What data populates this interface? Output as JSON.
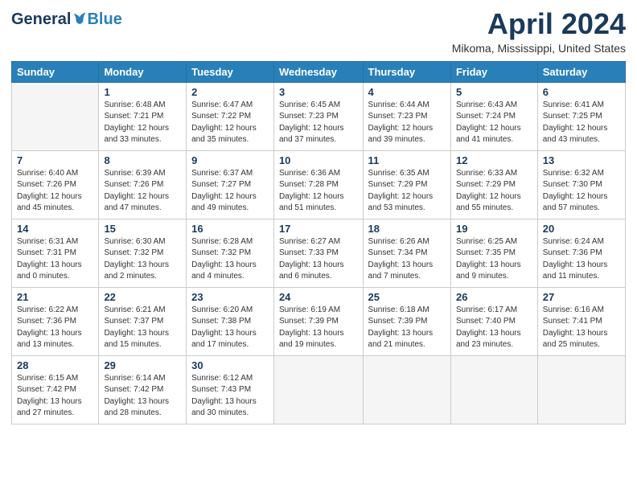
{
  "header": {
    "logo_general": "General",
    "logo_blue": "Blue",
    "month": "April 2024",
    "location": "Mikoma, Mississippi, United States"
  },
  "days_of_week": [
    "Sunday",
    "Monday",
    "Tuesday",
    "Wednesday",
    "Thursday",
    "Friday",
    "Saturday"
  ],
  "weeks": [
    [
      {
        "day": "",
        "info": ""
      },
      {
        "day": "1",
        "info": "Sunrise: 6:48 AM\nSunset: 7:21 PM\nDaylight: 12 hours\nand 33 minutes."
      },
      {
        "day": "2",
        "info": "Sunrise: 6:47 AM\nSunset: 7:22 PM\nDaylight: 12 hours\nand 35 minutes."
      },
      {
        "day": "3",
        "info": "Sunrise: 6:45 AM\nSunset: 7:23 PM\nDaylight: 12 hours\nand 37 minutes."
      },
      {
        "day": "4",
        "info": "Sunrise: 6:44 AM\nSunset: 7:23 PM\nDaylight: 12 hours\nand 39 minutes."
      },
      {
        "day": "5",
        "info": "Sunrise: 6:43 AM\nSunset: 7:24 PM\nDaylight: 12 hours\nand 41 minutes."
      },
      {
        "day": "6",
        "info": "Sunrise: 6:41 AM\nSunset: 7:25 PM\nDaylight: 12 hours\nand 43 minutes."
      }
    ],
    [
      {
        "day": "7",
        "info": "Sunrise: 6:40 AM\nSunset: 7:26 PM\nDaylight: 12 hours\nand 45 minutes."
      },
      {
        "day": "8",
        "info": "Sunrise: 6:39 AM\nSunset: 7:26 PM\nDaylight: 12 hours\nand 47 minutes."
      },
      {
        "day": "9",
        "info": "Sunrise: 6:37 AM\nSunset: 7:27 PM\nDaylight: 12 hours\nand 49 minutes."
      },
      {
        "day": "10",
        "info": "Sunrise: 6:36 AM\nSunset: 7:28 PM\nDaylight: 12 hours\nand 51 minutes."
      },
      {
        "day": "11",
        "info": "Sunrise: 6:35 AM\nSunset: 7:29 PM\nDaylight: 12 hours\nand 53 minutes."
      },
      {
        "day": "12",
        "info": "Sunrise: 6:33 AM\nSunset: 7:29 PM\nDaylight: 12 hours\nand 55 minutes."
      },
      {
        "day": "13",
        "info": "Sunrise: 6:32 AM\nSunset: 7:30 PM\nDaylight: 12 hours\nand 57 minutes."
      }
    ],
    [
      {
        "day": "14",
        "info": "Sunrise: 6:31 AM\nSunset: 7:31 PM\nDaylight: 13 hours\nand 0 minutes."
      },
      {
        "day": "15",
        "info": "Sunrise: 6:30 AM\nSunset: 7:32 PM\nDaylight: 13 hours\nand 2 minutes."
      },
      {
        "day": "16",
        "info": "Sunrise: 6:28 AM\nSunset: 7:32 PM\nDaylight: 13 hours\nand 4 minutes."
      },
      {
        "day": "17",
        "info": "Sunrise: 6:27 AM\nSunset: 7:33 PM\nDaylight: 13 hours\nand 6 minutes."
      },
      {
        "day": "18",
        "info": "Sunrise: 6:26 AM\nSunset: 7:34 PM\nDaylight: 13 hours\nand 7 minutes."
      },
      {
        "day": "19",
        "info": "Sunrise: 6:25 AM\nSunset: 7:35 PM\nDaylight: 13 hours\nand 9 minutes."
      },
      {
        "day": "20",
        "info": "Sunrise: 6:24 AM\nSunset: 7:36 PM\nDaylight: 13 hours\nand 11 minutes."
      }
    ],
    [
      {
        "day": "21",
        "info": "Sunrise: 6:22 AM\nSunset: 7:36 PM\nDaylight: 13 hours\nand 13 minutes."
      },
      {
        "day": "22",
        "info": "Sunrise: 6:21 AM\nSunset: 7:37 PM\nDaylight: 13 hours\nand 15 minutes."
      },
      {
        "day": "23",
        "info": "Sunrise: 6:20 AM\nSunset: 7:38 PM\nDaylight: 13 hours\nand 17 minutes."
      },
      {
        "day": "24",
        "info": "Sunrise: 6:19 AM\nSunset: 7:39 PM\nDaylight: 13 hours\nand 19 minutes."
      },
      {
        "day": "25",
        "info": "Sunrise: 6:18 AM\nSunset: 7:39 PM\nDaylight: 13 hours\nand 21 minutes."
      },
      {
        "day": "26",
        "info": "Sunrise: 6:17 AM\nSunset: 7:40 PM\nDaylight: 13 hours\nand 23 minutes."
      },
      {
        "day": "27",
        "info": "Sunrise: 6:16 AM\nSunset: 7:41 PM\nDaylight: 13 hours\nand 25 minutes."
      }
    ],
    [
      {
        "day": "28",
        "info": "Sunrise: 6:15 AM\nSunset: 7:42 PM\nDaylight: 13 hours\nand 27 minutes."
      },
      {
        "day": "29",
        "info": "Sunrise: 6:14 AM\nSunset: 7:42 PM\nDaylight: 13 hours\nand 28 minutes."
      },
      {
        "day": "30",
        "info": "Sunrise: 6:12 AM\nSunset: 7:43 PM\nDaylight: 13 hours\nand 30 minutes."
      },
      {
        "day": "",
        "info": ""
      },
      {
        "day": "",
        "info": ""
      },
      {
        "day": "",
        "info": ""
      },
      {
        "day": "",
        "info": ""
      }
    ]
  ]
}
